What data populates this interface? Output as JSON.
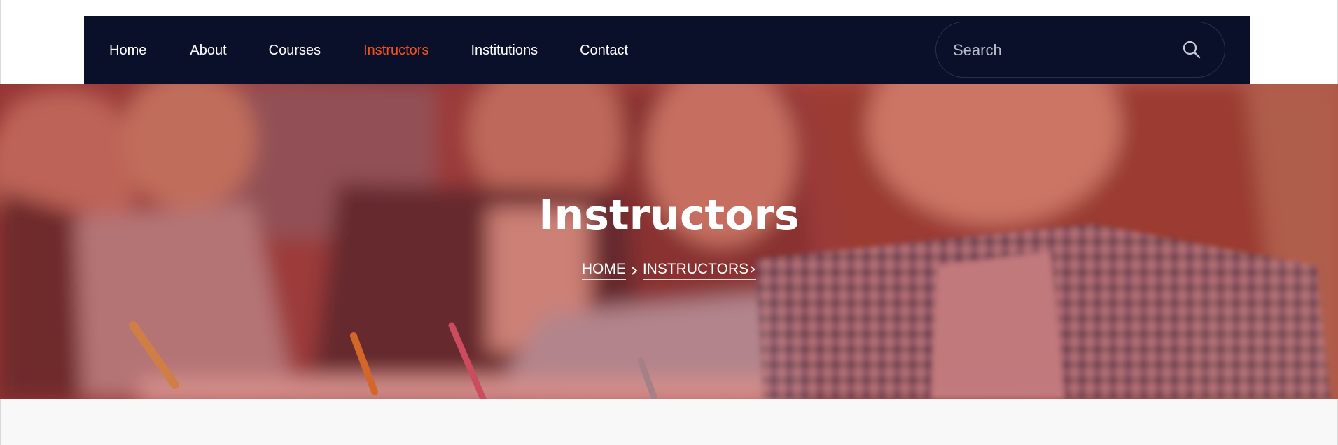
{
  "nav": {
    "items": [
      {
        "label": "Home",
        "active": false
      },
      {
        "label": "About",
        "active": false
      },
      {
        "label": "Courses",
        "active": false
      },
      {
        "label": "Instructors",
        "active": true
      },
      {
        "label": "Institutions",
        "active": false
      },
      {
        "label": "Contact",
        "active": false
      }
    ],
    "search": {
      "placeholder": "Search",
      "icon": "search-icon"
    }
  },
  "hero": {
    "title": "Instructors",
    "breadcrumb": {
      "home": "HOME",
      "current": "INSTRUCTORS"
    },
    "overlay_color": "#b03c3a"
  },
  "colors": {
    "nav_bg": "#0b102a",
    "accent": "#f4511e",
    "nav_text": "#ffffff"
  }
}
